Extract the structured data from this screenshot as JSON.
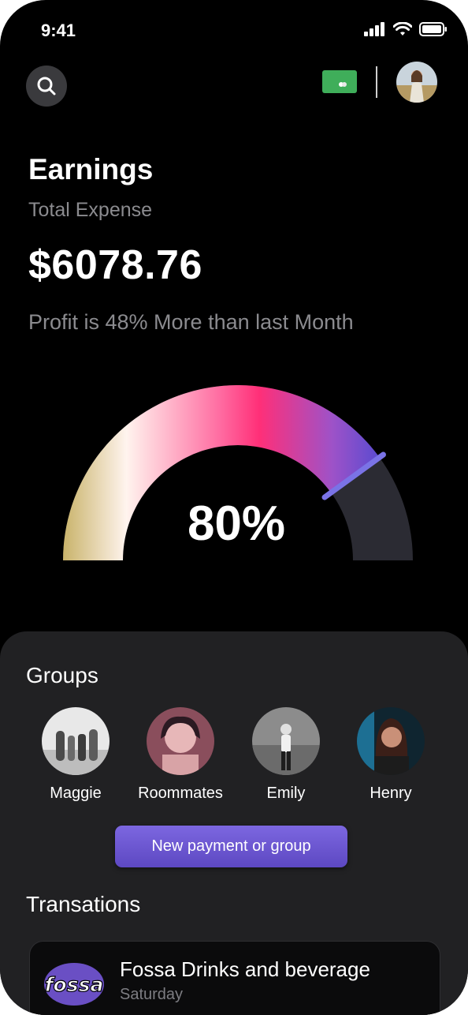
{
  "status_bar": {
    "time": "9:41"
  },
  "header": {
    "search_icon": "search-icon",
    "card_icon": "credit-card-icon",
    "colors": {
      "card": "#3fae5a"
    }
  },
  "earnings": {
    "title": "Earnings",
    "subtitle": "Total Expense",
    "amount": "$6078.76",
    "profit_text": "Profit is 48% More than last Month"
  },
  "gauge": {
    "percent_label": "80%",
    "value_fraction": 0.8,
    "colors": {
      "start": "#d6bf7a",
      "mid": "#ff2f78",
      "end": "#a24fc9",
      "track": "#2b2b33",
      "needle": "#7a73e6"
    }
  },
  "groups": {
    "heading": "Groups",
    "items": [
      {
        "name": "Maggie"
      },
      {
        "name": "Roommates"
      },
      {
        "name": "Emily"
      },
      {
        "name": "Henry"
      }
    ],
    "new_button": "New payment or group"
  },
  "transactions": {
    "heading": "Transations",
    "items": [
      {
        "logo_text": "fossa",
        "name": "Fossa Drinks and beverage",
        "day": "Saturday"
      }
    ]
  }
}
